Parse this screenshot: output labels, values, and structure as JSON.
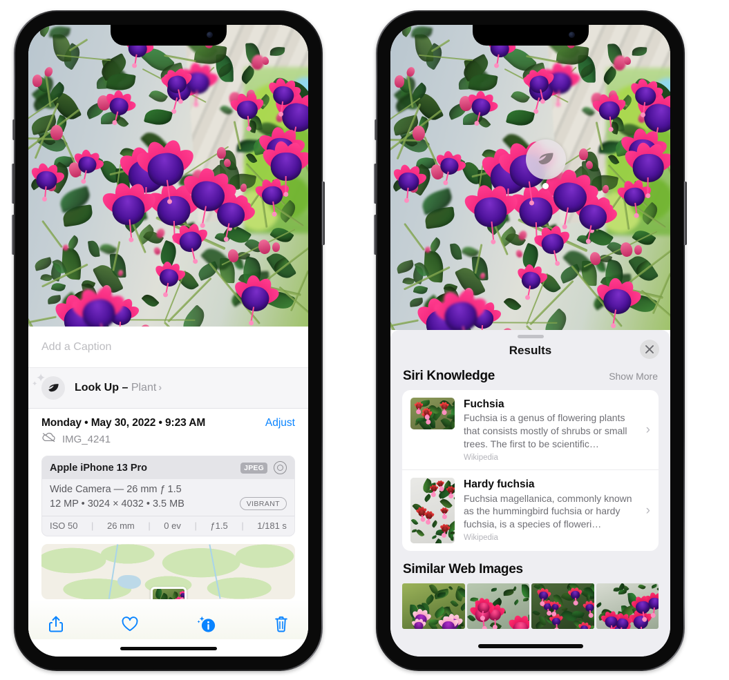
{
  "colors": {
    "accent_blue": "#0a84ff",
    "sheet_bg": "#eeeef2",
    "card_bg": "#ffffff",
    "muted_text": "#8e8e93",
    "panel_gray": "#f6f6f8"
  },
  "left_phone": {
    "name": "photos-info-screen",
    "caption_field": {
      "placeholder": "Add a Caption",
      "value": ""
    },
    "look_up": {
      "label": "Look Up",
      "dash": "–",
      "subject": "Plant",
      "chevron": "›"
    },
    "metadata": {
      "date": "Monday • May 30, 2022 • 9:23 AM",
      "adjust_label": "Adjust",
      "filename": "IMG_4241"
    },
    "camera_card": {
      "device": "Apple iPhone 13 Pro",
      "format_badge": "JPEG",
      "lens_line": "Wide Camera — 26 mm ƒ 1.5",
      "size_line": "12 MP • 3024 × 4032 • 3.5 MB",
      "style_badge": "VIBRANT",
      "exif": [
        "ISO 50",
        "26 mm",
        "0 ev",
        "ƒ1.5",
        "1/181 s"
      ]
    },
    "toolbar": {
      "share": "share-icon",
      "favorite": "heart-icon",
      "info": "info-sparkle-icon",
      "delete": "trash-icon"
    }
  },
  "right_phone": {
    "name": "visual-look-up-results-screen",
    "badge_icon": "leaf-icon",
    "sheet": {
      "title": "Results",
      "close_label": "✕",
      "sections": [
        {
          "title": "Siri Knowledge",
          "action": "Show More",
          "items": [
            {
              "title": "Fuchsia",
              "description": "Fuchsia is a genus of flowering plants that consists mostly of shrubs or small trees. The first to be scientific…",
              "source": "Wikipedia",
              "chevron": "›"
            },
            {
              "title": "Hardy fuchsia",
              "description": "Fuchsia magellanica, commonly known as the hummingbird fuchsia or hardy fuchsia, is a species of floweri…",
              "source": "Wikipedia",
              "chevron": "›"
            }
          ]
        },
        {
          "title": "Similar Web Images",
          "items": [
            "web-image-1",
            "web-image-2",
            "web-image-3",
            "web-image-4"
          ]
        }
      ]
    }
  }
}
